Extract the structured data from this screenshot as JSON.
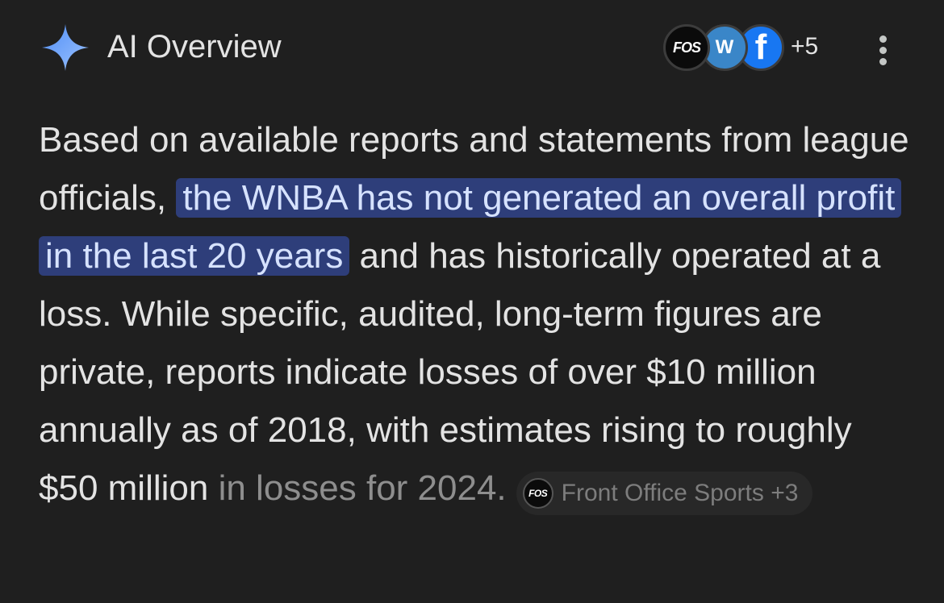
{
  "header": {
    "title": "AI Overview",
    "sparkle_icon": "sparkle-icon",
    "accent_color": "#8ab4f8",
    "sources": [
      {
        "name": "fos-source-avatar",
        "label": "FOS",
        "color": "#0b0b0b"
      },
      {
        "name": "w-source-avatar",
        "label": "W",
        "color": "#3a86c8"
      },
      {
        "name": "facebook-source-avatar",
        "label": "f",
        "color": "#1877f2"
      }
    ],
    "more_sources": "+5",
    "menu_icon": "more-vert-icon"
  },
  "overview": {
    "text_before": "Based on available reports and statements from league officials, ",
    "highlight": "the WNBA has not generated an overall profit in the last 20 years",
    "text_after": " and has historically operated at a loss. While specific, audited, long-term figures are private, reports indicate losses of over $10 million annually as of 2018, with estimates rising to roughly $50 million",
    "text_faded": " in losses for 2024.",
    "highlight_color": "#2e3e7a"
  },
  "citation_chip": {
    "logo": "FOS",
    "label": "Front Office Sports +3"
  }
}
